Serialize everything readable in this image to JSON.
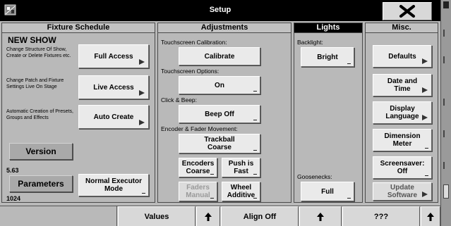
{
  "window": {
    "title": "Setup",
    "icon": "fixture-setup-icon",
    "close_icon": "close-x-icon"
  },
  "fixture_schedule": {
    "header": "Fixture Schedule",
    "show_name": "NEW SHOW",
    "items": [
      {
        "description": "Change Structure Of Show, Create or Delete Fixtures etc.",
        "button": "Full Access",
        "icon": "arrow-right-icon"
      },
      {
        "description": "Change Patch and Fixture Settings Live On Stage",
        "button": "Live Access",
        "icon": "arrow-right-icon"
      },
      {
        "description": "Automatic Creation of Presets, Groups and Effects",
        "button": "Auto Create",
        "icon": "arrow-right-icon"
      }
    ],
    "version_label": "Version",
    "version_value": "5.63",
    "parameters_label": "Parameters",
    "parameters_value": "1024",
    "executor_mode": "Normal Executor Mode"
  },
  "adjustments": {
    "header": "Adjustments",
    "touch_calibration_label": "Touchscreen Calibration:",
    "calibrate_button": "Calibrate",
    "touch_options_label": "Touchscreen Options:",
    "touch_options_value": "On",
    "click_beep_label": "Click & Beep:",
    "beep_value": "Beep Off",
    "encoder_label": "Encoder & Fader Movement:",
    "trackball_button": "Trackball Coarse",
    "encoders_button": "Encoders Coarse",
    "push_button": "Push is Fast",
    "faders_button": "Faders Manual",
    "wheel_button": "Wheel Additive"
  },
  "lights": {
    "header": "Lights",
    "backlight_label": "Backlight:",
    "backlight_value": "Bright",
    "goosenecks_label": "Goosenecks:",
    "goosenecks_value": "Full"
  },
  "misc": {
    "header": "Misc.",
    "items": [
      "Defaults",
      "Date and Time",
      "Display Language",
      "Dimension Meter",
      "Screensaver: Off",
      "Update Software"
    ]
  },
  "bottom_bar": {
    "values_label": "Values",
    "align_label": "Align Off",
    "question_label": "???",
    "arrow_icon": "arrow-up-icon"
  }
}
